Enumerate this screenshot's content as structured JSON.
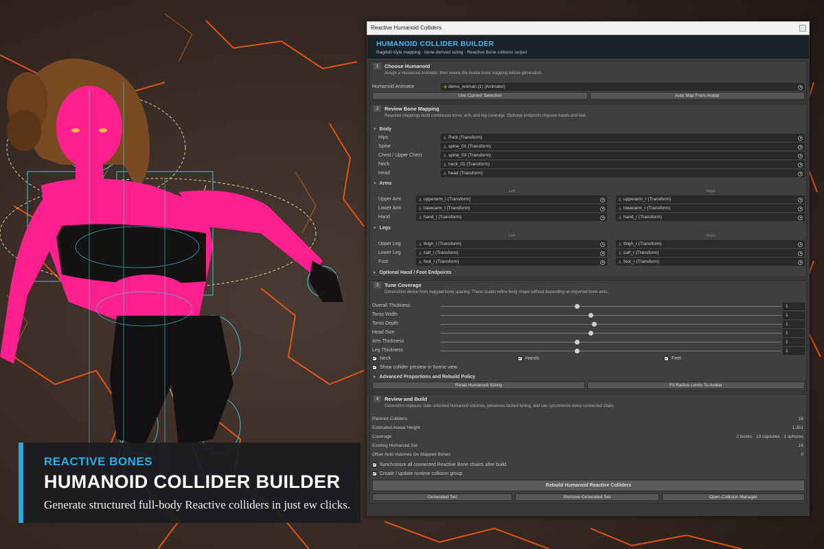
{
  "window": {
    "title": "Reactive Humanoid Colliders"
  },
  "header": {
    "title": "HUMANOID COLLIDER BUILDER",
    "subtitle": "Ragdoll-style mapping · bone-derived sizing · Reactive Bone collision output"
  },
  "s1": {
    "num": "1",
    "title": "Choose Humanoid",
    "desc": "Assign a Humanoid Animator, then review the Avatar bone mapping before generation.",
    "animator_label": "Humanoid Animator",
    "animator_value": "demo_woman (1) (Animator)",
    "btn_use": "Use Current Selection",
    "btn_auto": "Auto Map From Avatar"
  },
  "s2": {
    "num": "2",
    "title": "Review Bone Mapping",
    "desc": "Required mappings build continuous torso, arm, and leg coverage. Optional endpoints improve hands and feet.",
    "body_fold": "Body",
    "body": [
      {
        "label": "Hips",
        "value": "Root (Transform)"
      },
      {
        "label": "Spine",
        "value": "spine_01 (Transform)"
      },
      {
        "label": "Chest / Upper Chest",
        "value": "spine_03 (Transform)"
      },
      {
        "label": "Neck",
        "value": "neck_01 (Transform)"
      },
      {
        "label": "Head",
        "value": "head (Transform)"
      }
    ],
    "arms_fold": "Arms",
    "left": "Left",
    "right": "Right",
    "arms": [
      {
        "label": "Upper Arm",
        "left": "upperarm_l (Transform)",
        "right": "upperarm_r (Transform)"
      },
      {
        "label": "Lower Arm",
        "left": "lowerarm_l (Transform)",
        "right": "lowerarm_r (Transform)"
      },
      {
        "label": "Hand",
        "left": "hand_l (Transform)",
        "right": "hand_r (Transform)"
      }
    ],
    "legs_fold": "Legs",
    "legs": [
      {
        "label": "Upper Leg",
        "left": "thigh_l (Transform)",
        "right": "thigh_r (Transform)"
      },
      {
        "label": "Lower Leg",
        "left": "calf_l (Transform)",
        "right": "calf_r (Transform)"
      },
      {
        "label": "Foot",
        "left": "foot_l (Transform)",
        "right": "foot_r (Transform)"
      }
    ],
    "optional_fold": "Optional Hand / Foot Endpoints"
  },
  "s3": {
    "num": "3",
    "title": "Tune Coverage",
    "desc": "Dimensions derive from mapped bone spacing. These scales refine body shape without depending on imported bone axes.",
    "sliders": [
      {
        "label": "Overall Thickness",
        "value": "1",
        "pos": 0.4
      },
      {
        "label": "Torso Width",
        "value": "1",
        "pos": 0.44
      },
      {
        "label": "Torso Depth",
        "value": "1",
        "pos": 0.45
      },
      {
        "label": "Head Size",
        "value": "1",
        "pos": 0.44
      },
      {
        "label": "Arm Thickness",
        "value": "1",
        "pos": 0.4
      },
      {
        "label": "Leg Thickness",
        "value": "1",
        "pos": 0.4
      }
    ],
    "chk_neck": "Neck",
    "chk_hands": "Hands",
    "chk_feet": "Feet",
    "chk_preview": "Show collider preview in Scene view",
    "adv_fold": "Advanced Proportions and Rebuild Policy",
    "btn_reset": "Reset Humanoid Sizing",
    "btn_fit": "Fit Radius Limits To Avatar"
  },
  "s4": {
    "num": "4",
    "title": "Review and Build",
    "desc": "Generation replaces stale unlocked humanoid volumes, preserves locked tuning, and can synchronize every connected chain.",
    "stats": [
      {
        "label": "Planned Colliders",
        "value": "16"
      },
      {
        "label": "Estimated Avatar Height",
        "value": "1.351"
      },
      {
        "label": "Coverage",
        "value": "2 boxes · 13 capsules · 1 spheres"
      },
      {
        "label": "Existing Humanoid Set",
        "value": "16"
      },
      {
        "label": "Other Auto Volumes On Mapped Bones",
        "value": "0"
      }
    ],
    "chk_sync": "Synchronize all connected Reactive Bone chains after build",
    "chk_group": "Create / update runtime collision group",
    "btn_rebuild": "Rebuild Humanoid Reactive Colliders",
    "btn_generated": "Generated Set",
    "btn_remove": "Remove Generated Set",
    "btn_open": "Open Collision Manager"
  },
  "promo": {
    "tag": "REACTIVE BONES",
    "title": "HUMANOID COLLIDER BUILDER",
    "sub": "Generate structured full-body Reactive colliders in just ew clicks."
  },
  "colors": {
    "accent": "#29aee9",
    "skin": "#ff1f8f",
    "wire": "#3ad8f0",
    "lava": "#ff5a14"
  }
}
